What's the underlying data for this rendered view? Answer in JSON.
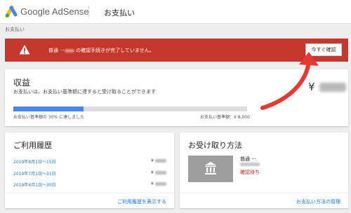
{
  "header": {
    "brand": "Google AdSense",
    "page_title": "お支払い"
  },
  "breadcrumb": "お支払い",
  "alert": {
    "text_before": "普通 ···",
    "text_after": " の確認手続きが完了していません。",
    "button": "今すぐ確認"
  },
  "earnings": {
    "title": "収益",
    "subtitle": "お支払いは、お支払い基準額に達すると受け取ることができます",
    "currency": "¥",
    "progress_percent": 30,
    "progress_label": "お支払い基準額の 30% に達しました",
    "threshold_label": "お支払い基準額：¥ 8,000"
  },
  "history": {
    "title": "ご利用履歴",
    "rows": [
      {
        "period": "2019年8月1日〜15日",
        "currency": "¥"
      },
      {
        "period": "2019年7月1日〜31日",
        "currency": "¥"
      },
      {
        "period": "2019年6月1日〜30日",
        "currency": "¥"
      }
    ],
    "link": "ご利用履歴を表示する"
  },
  "payment_method": {
    "title": "お受け取り方法",
    "account": "普通 ···",
    "status": "確認待ち",
    "link": "お支払い方法の管理"
  },
  "colors": {
    "alert_bg": "#c4372a",
    "progress_fill": "#4a86e8",
    "link": "#1a73e8",
    "status_pending": "#c5221f",
    "annotation_arrow": "#e53935"
  }
}
